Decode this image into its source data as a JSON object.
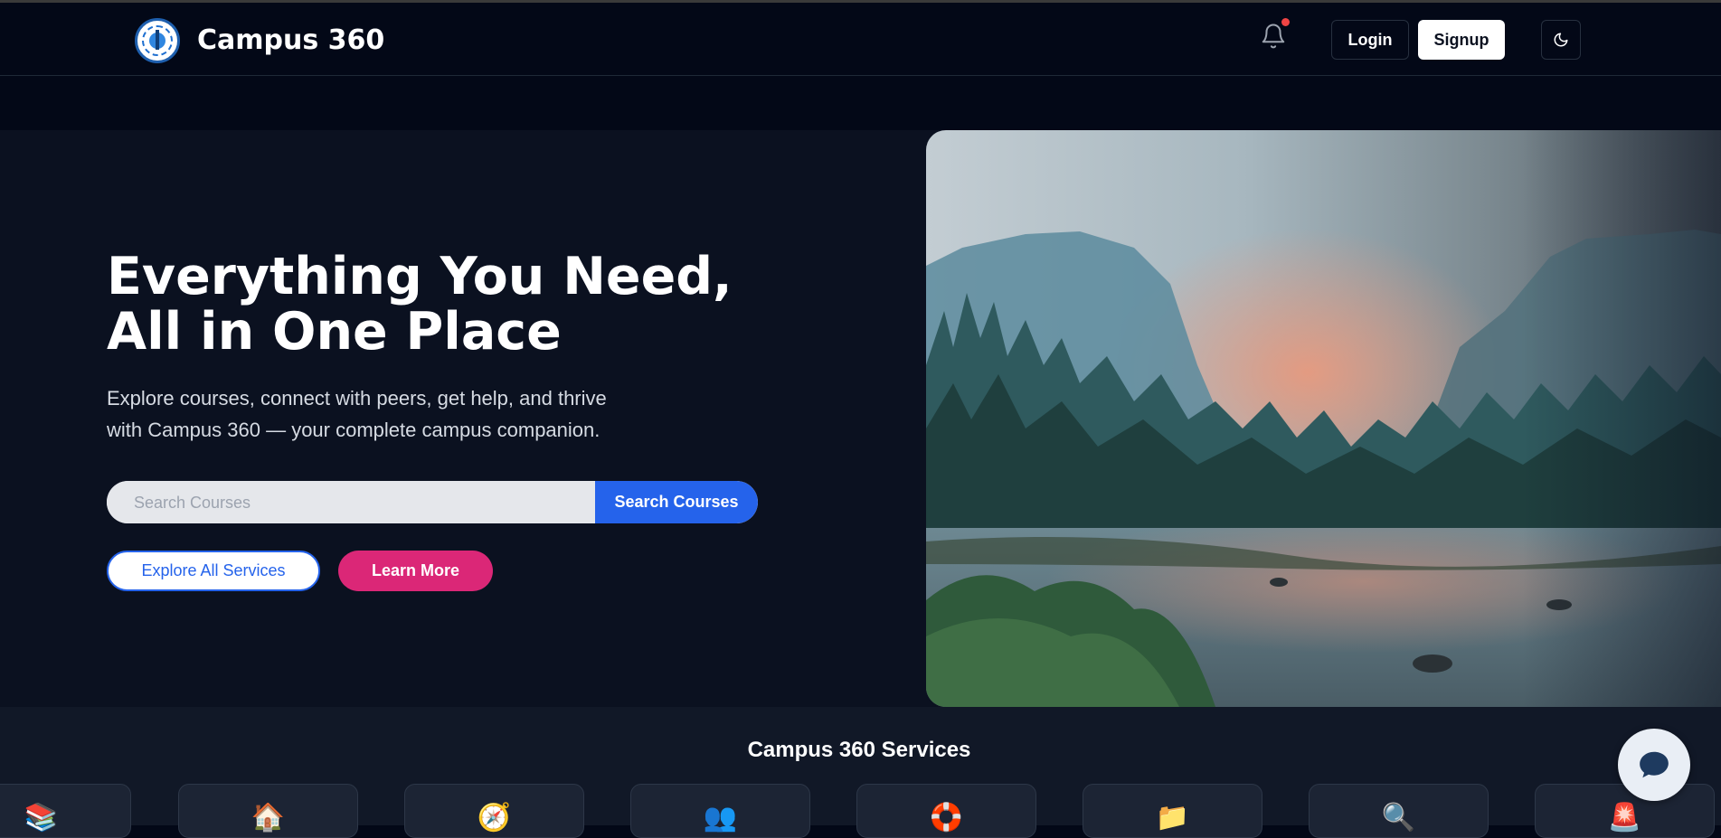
{
  "navbar": {
    "brand": "Campus 360",
    "login_label": "Login",
    "signup_label": "Signup",
    "notification_icon": "bell-icon",
    "theme_icon": "moon-icon"
  },
  "hero": {
    "headline_line1": "Everything You Need,",
    "headline_line2": "All in One Place",
    "subtitle_line1": "Explore courses, connect with peers, get help, and thrive",
    "subtitle_line2": "with Campus 360 — your complete campus companion.",
    "search_placeholder": "Search Courses",
    "search_button": "Search Courses",
    "explore_button": "Explore All Services",
    "learn_more_button": "Learn More"
  },
  "services": {
    "title": "Campus 360 Services",
    "cards": [
      {
        "icon": "books-icon",
        "glyph": "📚"
      },
      {
        "icon": "house-icon",
        "glyph": "🏠"
      },
      {
        "icon": "compass-icon",
        "glyph": "🧭"
      },
      {
        "icon": "people-icon",
        "glyph": "👥"
      },
      {
        "icon": "lifebuoy-icon",
        "glyph": "🛟"
      },
      {
        "icon": "folder-icon",
        "glyph": "📁"
      },
      {
        "icon": "search-icon",
        "glyph": "🔍"
      },
      {
        "icon": "alert-icon",
        "glyph": "🚨"
      }
    ]
  },
  "chat": {
    "icon": "chat-icon"
  },
  "colors": {
    "page_bg": "#030817",
    "hero_bg": "#0b1120",
    "accent_blue": "#2563eb",
    "accent_pink": "#db2777",
    "notification_dot": "#ef4444"
  }
}
